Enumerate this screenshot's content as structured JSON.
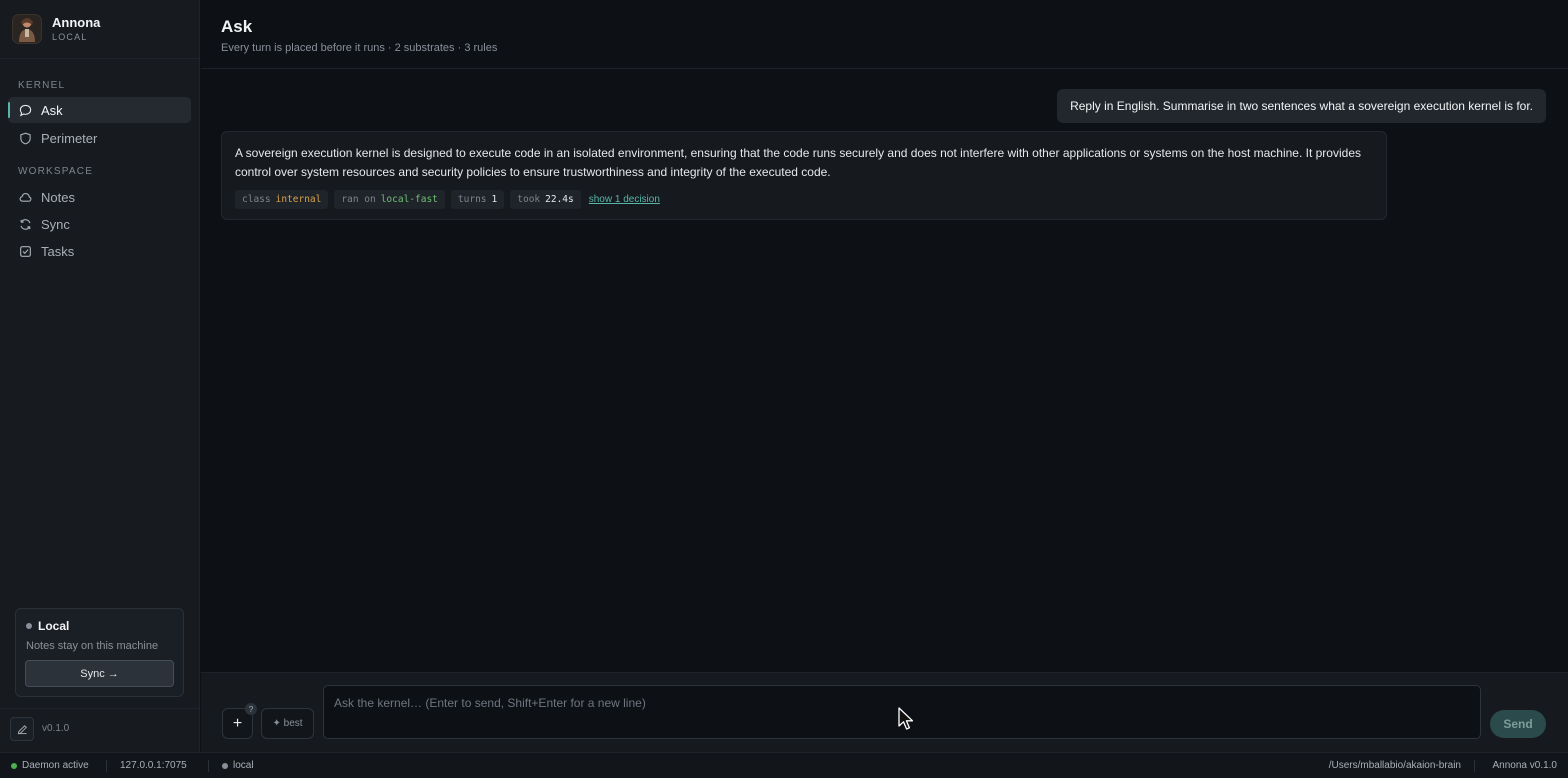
{
  "sidebar": {
    "app_name": "Annona",
    "mode": "LOCAL",
    "sections": {
      "kernel": "KERNEL",
      "workspace": "WORKSPACE"
    },
    "kernel_items": [
      {
        "label": "Ask",
        "icon": "chat-bubble-icon",
        "active": true
      },
      {
        "label": "Perimeter",
        "icon": "shield-icon",
        "active": false
      }
    ],
    "workspace_items": [
      {
        "label": "Notes",
        "icon": "cloud-icon"
      },
      {
        "label": "Sync",
        "icon": "refresh-icon"
      },
      {
        "label": "Tasks",
        "icon": "checkbox-icon"
      }
    ],
    "local_card": {
      "title": "Local",
      "subtitle": "Notes stay on this machine",
      "sync_label": "Sync →"
    },
    "version": "v0.1.0"
  },
  "header": {
    "title": "Ask",
    "subtitle": "Every turn is placed before it runs · 2 substrates · 3 rules"
  },
  "conversation": {
    "user_message": "Reply in English. Summarise in two sentences what a sovereign execution kernel is for.",
    "assistant_message": "A sovereign execution kernel is designed to execute code in an isolated environment, ensuring that the code runs securely and does not interfere with other applications or systems on the host machine. It provides control over system resources and security policies to ensure trustworthiness and integrity of the executed code.",
    "meta": {
      "class_label": "class",
      "class_value": "internal",
      "ran_label": "ran on",
      "ran_value": "local-fast",
      "turns_label": "turns",
      "turns_value": "1",
      "took_label": "took",
      "took_value": "22.4s",
      "decision_link": "show 1 decision"
    }
  },
  "composer": {
    "placeholder": "Ask the kernel… (Enter to send, Shift+Enter for a new line)",
    "plus_label": "+",
    "help_badge": "?",
    "best_label": "✦ best",
    "send_label": "Send"
  },
  "statusbar": {
    "daemon": "Daemon active",
    "address": "127.0.0.1:7075",
    "mode": "local",
    "path": "/Users/mballabio/akaion-brain",
    "app_version": "Annona v0.1.0"
  },
  "colors": {
    "accent": "#58b6a8",
    "class_value": "#d5a24a",
    "ran_value": "#6fbf73",
    "daemon_status": "#4caf50"
  }
}
